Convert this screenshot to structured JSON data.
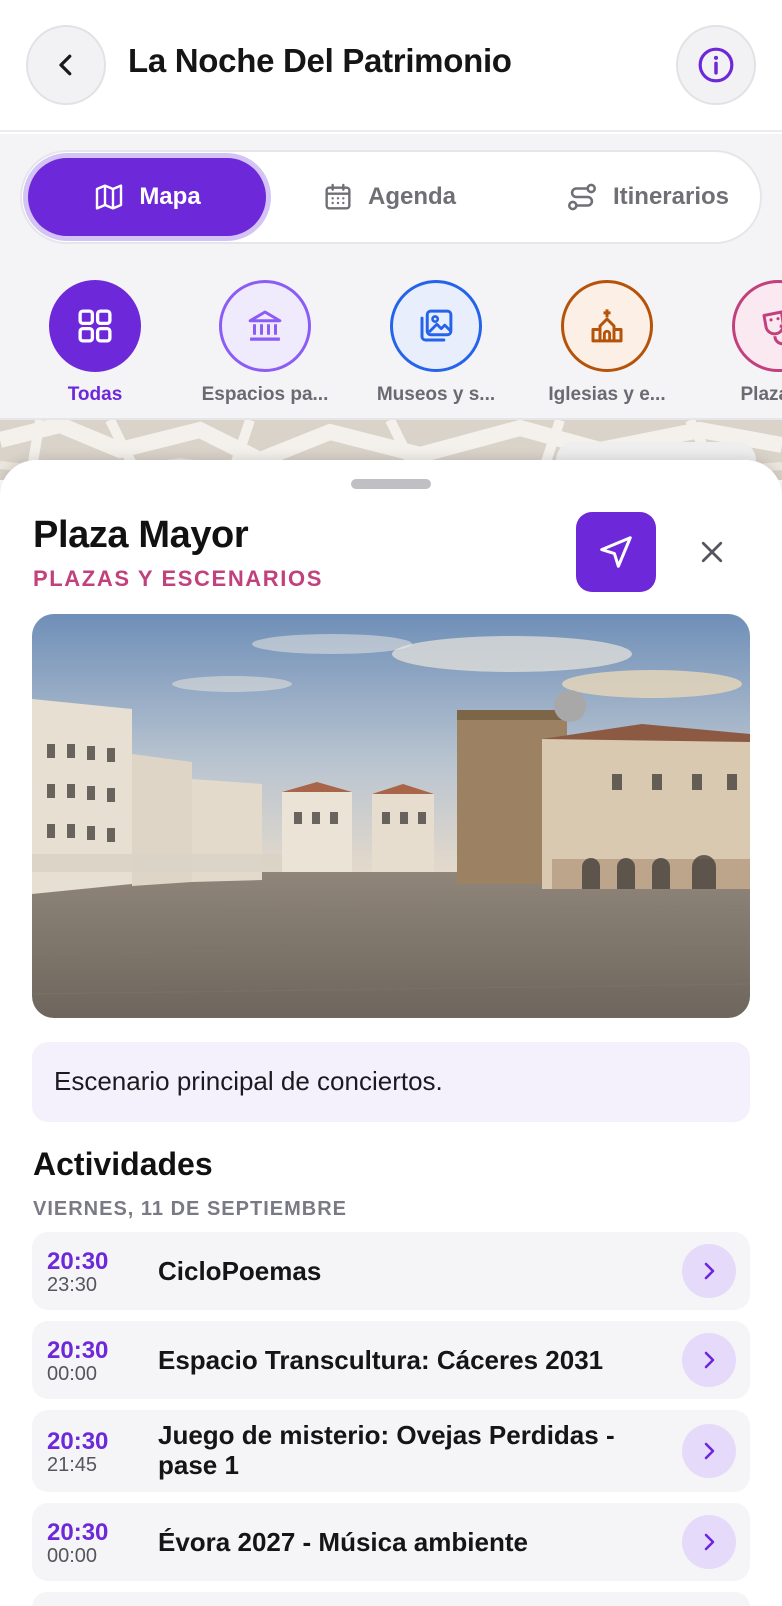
{
  "header": {
    "title": "La Noche Del Patrimonio",
    "back_icon": "chevron-left-icon",
    "info_icon": "info-icon"
  },
  "tabs": [
    {
      "label": "Mapa",
      "icon": "map-icon",
      "active": true
    },
    {
      "label": "Agenda",
      "icon": "calendar-icon",
      "active": false
    },
    {
      "label": "Itinerarios",
      "icon": "route-icon",
      "active": false
    }
  ],
  "categories": [
    {
      "label": "Todas",
      "icon": "grid-icon",
      "active": true,
      "color": "#6d28d9"
    },
    {
      "label": "Espacios pa...",
      "icon": "institution-icon",
      "active": false,
      "color": "#8b5cf6"
    },
    {
      "label": "Museos y s...",
      "icon": "gallery-icon",
      "active": false,
      "color": "#2563eb"
    },
    {
      "label": "Iglesias y e...",
      "icon": "church-icon",
      "active": false,
      "color": "#b45309"
    },
    {
      "label": "Plazas y",
      "icon": "masks-icon",
      "active": false,
      "color": "#c2417c"
    }
  ],
  "place": {
    "name": "Plaza Mayor",
    "category": "PLAZAS Y ESCENARIOS",
    "description": "Escenario principal de conciertos."
  },
  "activities": {
    "title": "Actividades",
    "date": "VIERNES, 11 DE SEPTIEMBRE",
    "items": [
      {
        "start": "20:30",
        "end": "23:30",
        "title": "CicloPoemas"
      },
      {
        "start": "20:30",
        "end": "00:00",
        "title": "Espacio Transcultura: Cáceres 2031"
      },
      {
        "start": "20:30",
        "end": "21:45",
        "title": "Juego de misterio: Ovejas Perdidas - pase 1"
      },
      {
        "start": "20:30",
        "end": "00:00",
        "title": "Évora 2027 - Música ambiente"
      }
    ]
  },
  "colors": {
    "accent": "#6d28d9",
    "category_pink": "#c2417c"
  }
}
